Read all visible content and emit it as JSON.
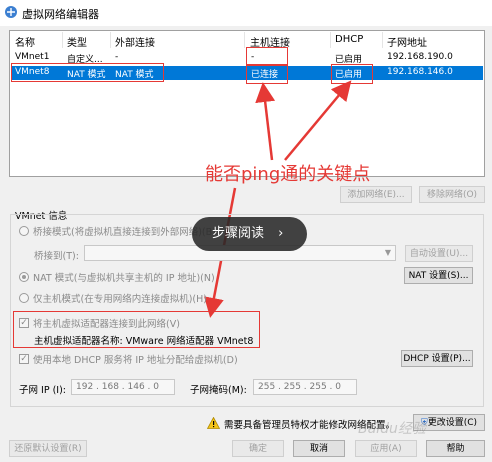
{
  "window": {
    "title": "虚拟网络编辑器"
  },
  "table": {
    "headers": [
      "名称",
      "类型",
      "外部连接",
      "主机连接",
      "DHCP",
      "子网地址"
    ],
    "rows": [
      {
        "name": "VMnet1",
        "type": "自定义...",
        "external": "-",
        "host": "-",
        "dhcp": "已启用",
        "subnet": "192.168.190.0",
        "selected": false
      },
      {
        "name": "VMnet8",
        "type": "NAT 模式",
        "external": "NAT 模式",
        "host": "已连接",
        "dhcp": "已启用",
        "subnet": "192.168.146.0",
        "selected": true
      }
    ]
  },
  "buttons": {
    "add_network": "添加网络(E)...",
    "remove_network": "移除网络(O)",
    "auto_settings": "自动设置(U)...",
    "nat_settings": "NAT 设置(S)...",
    "dhcp_settings": "DHCP 设置(P)...",
    "change_settings": "更改设置(C)",
    "restore_defaults": "还原默认设置(R)",
    "ok": "确定",
    "cancel": "取消",
    "apply": "应用(A)",
    "help": "帮助"
  },
  "vmnet_info": {
    "group_label": "VMnet 信息",
    "bridge_mode": "桥接模式(将虚拟机直接连接到外部网络)(B)",
    "bridge_to_label": "桥接到(T):",
    "nat_mode": "NAT 模式(与虚拟机共享主机的 IP 地址)(N)",
    "host_only": "仅主机模式(在专用网络内连接虚拟机)(H)",
    "connect_adapter": "将主机虚拟适配器连接到此网络(V)",
    "adapter_name": "主机虚拟适配器名称: VMware 网络适配器 VMnet8",
    "use_dhcp": "使用本地 DHCP 服务将 IP 地址分配给虚拟机(D)",
    "subnet_ip_label": "子网 IP (I):",
    "subnet_ip_value": "192 . 168 . 146 . 0",
    "subnet_mask_label": "子网掩码(M):",
    "subnet_mask_value": "255 . 255 . 255 . 0"
  },
  "admin_notice": "需要具备管理员特权才能修改网络配置。",
  "overlay": {
    "read_steps": "步骤阅读",
    "arrow": "›"
  },
  "annotation": "能否ping通的关键点",
  "watermark": "Baidu经验",
  "colors": {
    "accent": "#0078d7",
    "annotation": "#e53935"
  }
}
